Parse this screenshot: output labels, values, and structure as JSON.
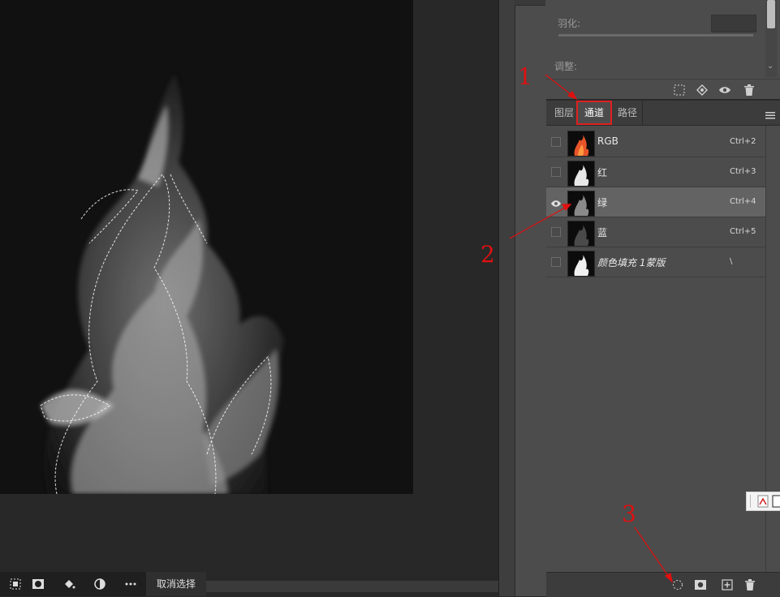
{
  "properties": {
    "feather_label": "羽化:",
    "adjust_label": "调整:"
  },
  "tabs": [
    {
      "label": "图层"
    },
    {
      "label": "通道"
    },
    {
      "label": "路径"
    }
  ],
  "channels": [
    {
      "name": "RGB",
      "shortcut": "Ctrl+2",
      "visible": false,
      "selected": false
    },
    {
      "name": "红",
      "shortcut": "Ctrl+3",
      "visible": false,
      "selected": false
    },
    {
      "name": "绿",
      "shortcut": "Ctrl+4",
      "visible": true,
      "selected": true
    },
    {
      "name": "蓝",
      "shortcut": "Ctrl+5",
      "visible": false,
      "selected": false
    },
    {
      "name": "颜色填充 1蒙版",
      "shortcut": "\\",
      "visible": false,
      "selected": false
    }
  ],
  "toolbar": {
    "deselect_label": "取消选择"
  },
  "annotations": {
    "one": "1",
    "two": "2",
    "three": "3"
  },
  "colors": {
    "panel_bg": "#4c4c4c",
    "selected_row": "#636363",
    "annotation_red": "#e01010"
  },
  "icons": {
    "dashed_circle": "dashed-selection-icon",
    "mask": "mask-icon",
    "new": "new-channel-icon",
    "trash": "trash-icon",
    "eye": "eye-icon",
    "menu": "menu-icon"
  }
}
